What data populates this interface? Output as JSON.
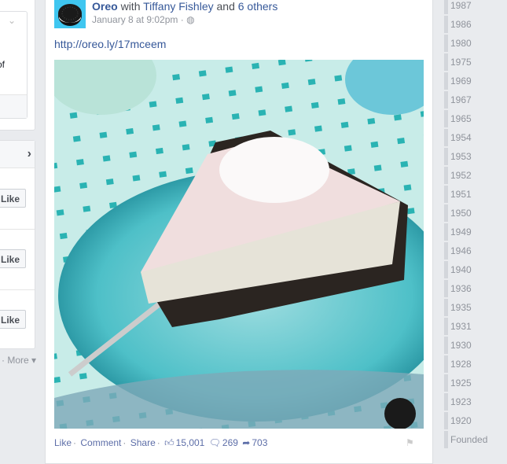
{
  "left_panel": {
    "partial_text": "of",
    "like_buttons": [
      "Like",
      "Like",
      "Like"
    ],
    "more": "· More ▾"
  },
  "post": {
    "author": "Oreo",
    "with": "with",
    "tagged": "Tiffany Fishley",
    "and": "and",
    "others": "6 others",
    "timestamp": "January 8 at 9:02pm",
    "privacy_icon": "globe-icon",
    "link": "http://oreo.ly/17mceem",
    "actions": {
      "like": "Like",
      "comment": "Comment",
      "share": "Share"
    },
    "counts": {
      "likes": "15,001",
      "comments": "269",
      "shares": "703"
    }
  },
  "timeline": {
    "years": [
      "1987",
      "1986",
      "1980",
      "1975",
      "1969",
      "1967",
      "1965",
      "1954",
      "1953",
      "1952",
      "1951",
      "1950",
      "1949",
      "1946",
      "1940",
      "1936",
      "1935",
      "1931",
      "1930",
      "1928",
      "1925",
      "1923",
      "1920",
      "Founded"
    ]
  },
  "colors": {
    "link": "#365899",
    "avatar_bg": "#3fc6f0",
    "background": "#e9ebee"
  }
}
